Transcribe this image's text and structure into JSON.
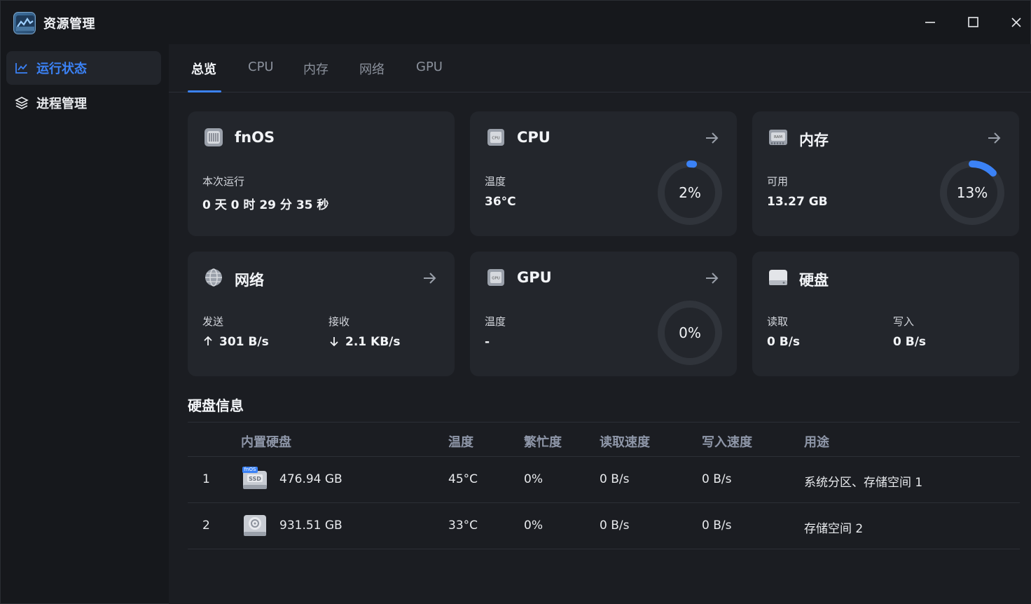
{
  "app": {
    "title": "资源管理",
    "icon": "monitor-app-icon"
  },
  "window_controls": {
    "minimize": "—",
    "maximize": "☐",
    "close": "✕"
  },
  "sidebar": {
    "items": [
      {
        "label": "运行状态",
        "icon": "chart-line-icon",
        "active": true
      },
      {
        "label": "进程管理",
        "icon": "layers-icon",
        "active": false
      }
    ]
  },
  "tabs": [
    {
      "label": "总览",
      "active": true
    },
    {
      "label": "CPU",
      "active": false
    },
    {
      "label": "内存",
      "active": false
    },
    {
      "label": "网络",
      "active": false
    },
    {
      "label": "GPU",
      "active": false
    }
  ],
  "cards": {
    "fnos": {
      "title": "fnOS",
      "icon": "server-chip-icon",
      "label": "本次运行",
      "value": "0 天 0 时 29 分 35 秒"
    },
    "cpu": {
      "title": "CPU",
      "icon": "cpu-chip-icon",
      "label": "温度",
      "value": "36°C",
      "gauge_text": "2%",
      "gauge_percent": 2
    },
    "memory": {
      "title": "内存",
      "icon": "ram-chip-icon",
      "label": "可用",
      "value": "13.27 GB",
      "gauge_text": "13%",
      "gauge_percent": 13
    },
    "network": {
      "title": "网络",
      "icon": "globe-icon",
      "send_label": "发送",
      "send_value": "301 B/s",
      "recv_label": "接收",
      "recv_value": "2.1 KB/s",
      "send_icon": "arrow-up-icon",
      "recv_icon": "arrow-down-icon"
    },
    "gpu": {
      "title": "GPU",
      "icon": "gpu-chip-icon",
      "label": "温度",
      "value": "-",
      "gauge_text": "0%",
      "gauge_percent": 0
    },
    "disk": {
      "title": "硬盘",
      "icon": "disk-drive-icon",
      "read_label": "读取",
      "read_value": "0 B/s",
      "write_label": "写入",
      "write_value": "0 B/s"
    }
  },
  "disk_info": {
    "title": "硬盘信息",
    "columns": [
      "内置硬盘",
      "温度",
      "繁忙度",
      "读取速度",
      "写入速度",
      "用途"
    ],
    "rows": [
      {
        "index": "1",
        "icon": "ssd-icon",
        "badge": "fnOS",
        "capacity": "476.94 GB",
        "temp": "45°C",
        "busy": "0%",
        "read": "0 B/s",
        "write": "0 B/s",
        "usage": "系统分区、存储空间 1"
      },
      {
        "index": "2",
        "icon": "hdd-icon",
        "capacity": "931.51 GB",
        "temp": "33°C",
        "busy": "0%",
        "read": "0 B/s",
        "write": "0 B/s",
        "usage": "存储空间 2"
      }
    ]
  },
  "colors": {
    "accent": "#3b82f6",
    "background": "#16181c",
    "card": "#23262c"
  }
}
